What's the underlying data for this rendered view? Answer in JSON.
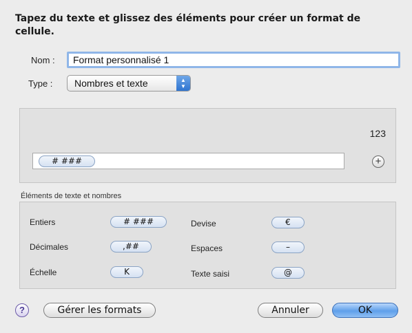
{
  "dialog": {
    "heading": "Tapez du texte et glissez des éléments pour créer un format de cellule."
  },
  "name_field": {
    "label": "Nom :",
    "value": "Format personnalisé 1"
  },
  "type_field": {
    "label": "Type :",
    "selected": "Nombres et texte"
  },
  "preview": {
    "sample": "123",
    "token": "# ###"
  },
  "elements": {
    "label": "Éléments de texte et nombres",
    "items": [
      {
        "label": "Entiers",
        "token": "# ###"
      },
      {
        "label": "Décimales",
        "token": ",##"
      },
      {
        "label": "Échelle",
        "token": "K"
      },
      {
        "label": "Devise",
        "token": "€"
      },
      {
        "label": "Espaces",
        "token": "–"
      },
      {
        "label": "Texte saisi",
        "token": "@"
      }
    ]
  },
  "buttons": {
    "help": "?",
    "manage": "Gérer les formats",
    "cancel": "Annuler",
    "ok": "OK"
  },
  "icons": {
    "add": "plus-icon",
    "stepper": "up-down-arrows-icon",
    "help": "question-icon"
  }
}
